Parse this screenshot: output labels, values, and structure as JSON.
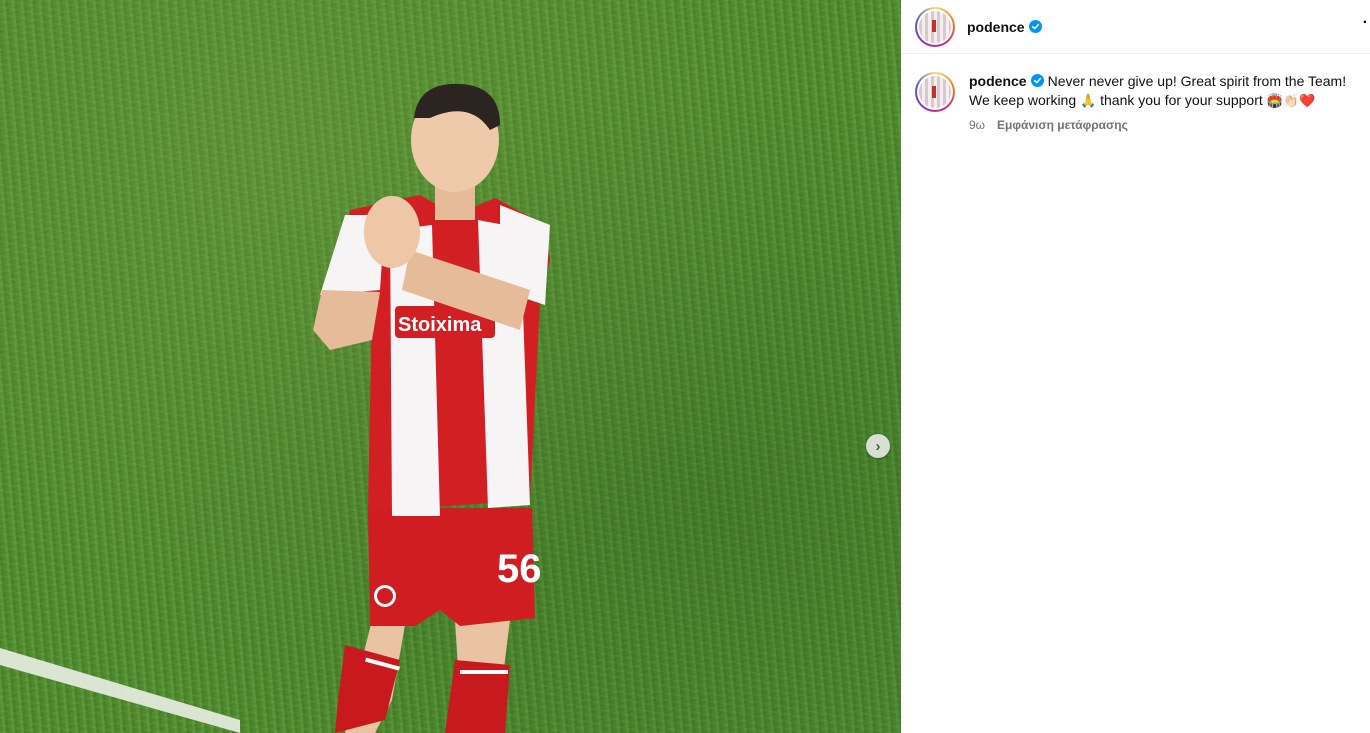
{
  "post": {
    "username": "podence",
    "caption_text": "Never never give up! Great spirit from the Team! We keep working",
    "emoji_pray": "🙏",
    "caption_text_2": "thank you for your support",
    "emoji_stadium": "🏟️",
    "emoji_clap": "👏🏻",
    "emoji_heart": "❤️",
    "time_ago": "9ω",
    "translate_label": "Εμφάνιση μετάφρασης"
  },
  "icons": {
    "verified": "verified-badge-icon",
    "more": "more-options-icon",
    "next": "chevron-right-icon"
  },
  "colors": {
    "verified": "#0095f6",
    "meta_text": "#737373"
  }
}
